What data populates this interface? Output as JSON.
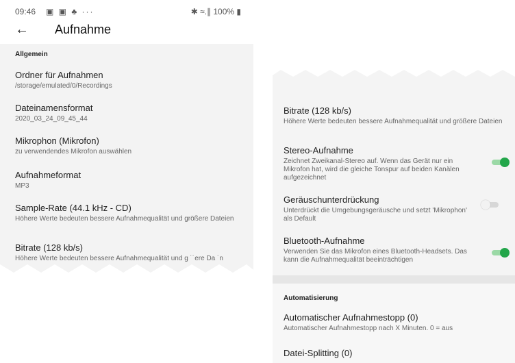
{
  "status_bar": {
    "time": "09:46",
    "left_icons": "▣ ▣ ♣  ···",
    "right_icons": "✱ ≈.∥ 100% ▮"
  },
  "app_bar": {
    "back": "←",
    "title": "Aufnahme"
  },
  "left": {
    "section": "Allgemein",
    "items": [
      {
        "title": "Ordner für Aufnahmen",
        "sub": "/storage/emulated/0/Recordings"
      },
      {
        "title": "Dateinamensformat",
        "sub": "2020_03_24_09_45_44"
      },
      {
        "title": "Mikrophon (Mikrofon)",
        "sub": "zu verwendendes Mikrofon auswählen"
      },
      {
        "title": "Aufnahmeformat",
        "sub": "MP3"
      },
      {
        "title": "Sample-Rate (44.1 kHz - CD)",
        "sub": "Höhere Werte bedeuten bessere Aufnahmequalität und größere Dateien"
      },
      {
        "title": "Bitrate (128 kb/s)",
        "sub": "Höhere Werte bedeuten bessere Aufnahmequalität und g  ˙˙ere Da  ˙n"
      }
    ]
  },
  "right": {
    "items": [
      {
        "title": "Bitrate (128 kb/s)",
        "sub": "Höhere Werte bedeuten bessere Aufnahmequalität und größere Dateien"
      },
      {
        "title": "Stereo-Aufnahme",
        "sub": "Zeichnet Zweikanal-Stereo auf. Wenn das Gerät nur ein Mikrofon hat, wird die gleiche Tonspur auf beiden Kanälen aufgezeichnet",
        "toggle": "on"
      },
      {
        "title": "Geräuschunterdrückung",
        "sub": "Unterdrückt die Umgebungsgeräusche und setzt 'Mikrophon' als Default",
        "toggle": "off"
      },
      {
        "title": "Bluetooth-Aufnahme",
        "sub": "Verwenden Sie das Mikrofon eines Bluetooth-Headsets. Das kann die Aufnahmequalität beeinträchtigen",
        "toggle": "on"
      }
    ],
    "section": "Automatisierung",
    "auto_items": [
      {
        "title": "Automatischer Aufnahmestopp (0)",
        "sub": "Automatischer Aufnahmestopp nach X Minuten. 0 = aus"
      },
      {
        "title": "Datei-Splitting (0)"
      }
    ]
  },
  "colors": {
    "accent_green": "#23a64a",
    "toggle_track_on": "#9bd9a6",
    "background": "#f3f3f3"
  }
}
